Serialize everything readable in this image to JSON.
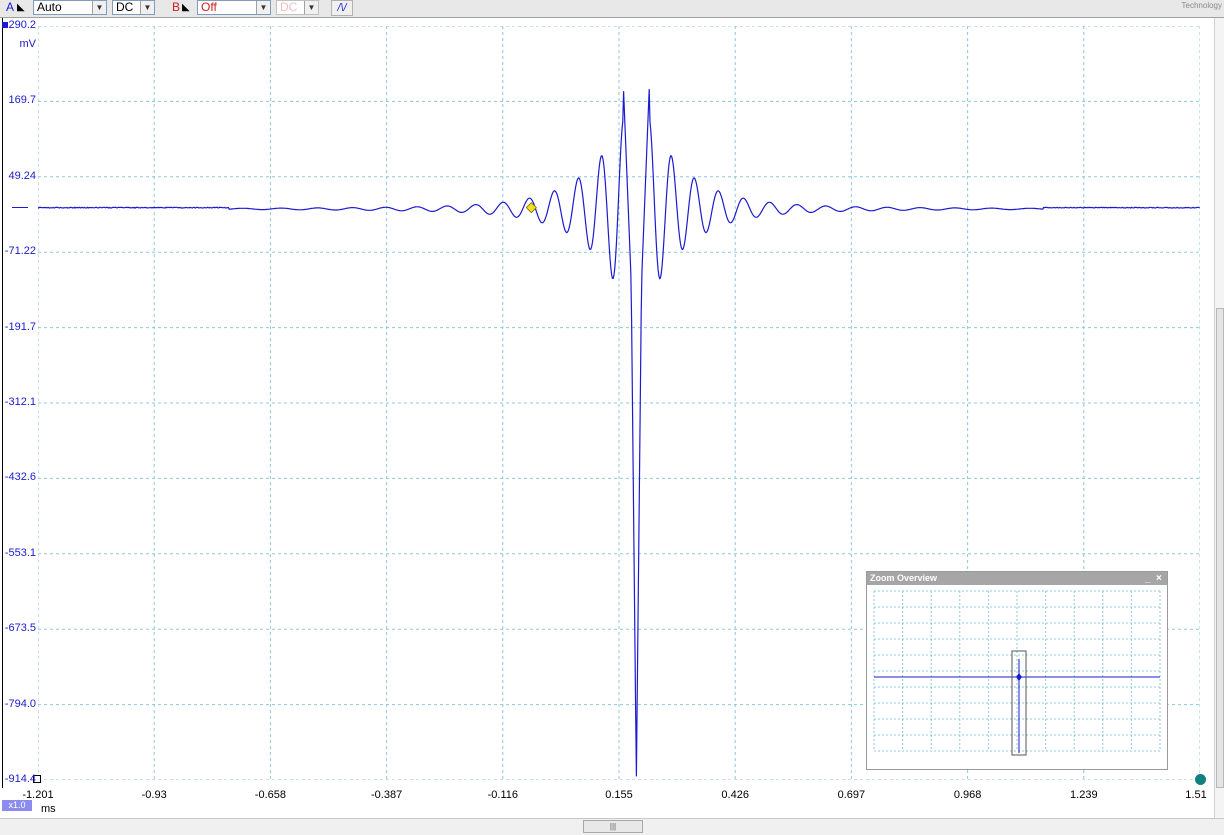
{
  "toolbar": {
    "channel_a": {
      "label": "A",
      "range": "Auto",
      "coupling": "DC"
    },
    "channel_b": {
      "label": "B",
      "range": "Off",
      "coupling": "DC"
    },
    "logo_text": "Technology"
  },
  "y_axis": {
    "unit": "mV",
    "ticks": [
      "290.2",
      "169.7",
      "49.24",
      "-71.22",
      "-191.7",
      "-312.1",
      "-432.6",
      "-553.1",
      "-673.5",
      "-794.0",
      "-914.4"
    ]
  },
  "x_axis": {
    "unit": "ms",
    "scale_badge": "x1.0",
    "ticks": [
      "-1.201",
      "-0.93",
      "-0.658",
      "-0.387",
      "-0.116",
      "0.155",
      "0.426",
      "0.697",
      "0.968",
      "1.239",
      "1.51"
    ]
  },
  "zoom_overview": {
    "title": "Zoom Overview",
    "minimize": "_",
    "close": "×"
  },
  "hscroll_grip": "|||",
  "colors": {
    "trace": "#1b1bd0",
    "grid": "#8fc8d8",
    "trigger_marker": "#f0e020",
    "trigger_dot": "#128080"
  },
  "chart_data": {
    "type": "line",
    "xlabel": "ms",
    "ylabel": "mV",
    "xlim": [
      -1.201,
      1.51
    ],
    "ylim": [
      -914.4,
      290.2
    ],
    "grid": true,
    "trigger": {
      "x": -0.05,
      "y": 0
    },
    "series": [
      {
        "x": [
          -1.201,
          -0.5,
          -0.43,
          -0.35,
          -0.3,
          -0.2,
          -0.1,
          -0.05,
          -0.02,
          0.02,
          0.08,
          0.1,
          0.13,
          0.16,
          0.18,
          0.185,
          0.195,
          0.205,
          0.21,
          0.23,
          0.25,
          0.28,
          0.3,
          0.33,
          0.38,
          0.45,
          0.55,
          0.7,
          0.8,
          1.51
        ],
        "y": [
          0,
          0,
          -2,
          -4,
          -6,
          -12,
          -22,
          -15,
          25,
          -35,
          60,
          -100,
          80,
          190,
          -130,
          -915,
          -915,
          -910,
          -120,
          190,
          -100,
          65,
          -35,
          30,
          -20,
          15,
          -8,
          -3,
          0,
          0
        ]
      }
    ]
  }
}
